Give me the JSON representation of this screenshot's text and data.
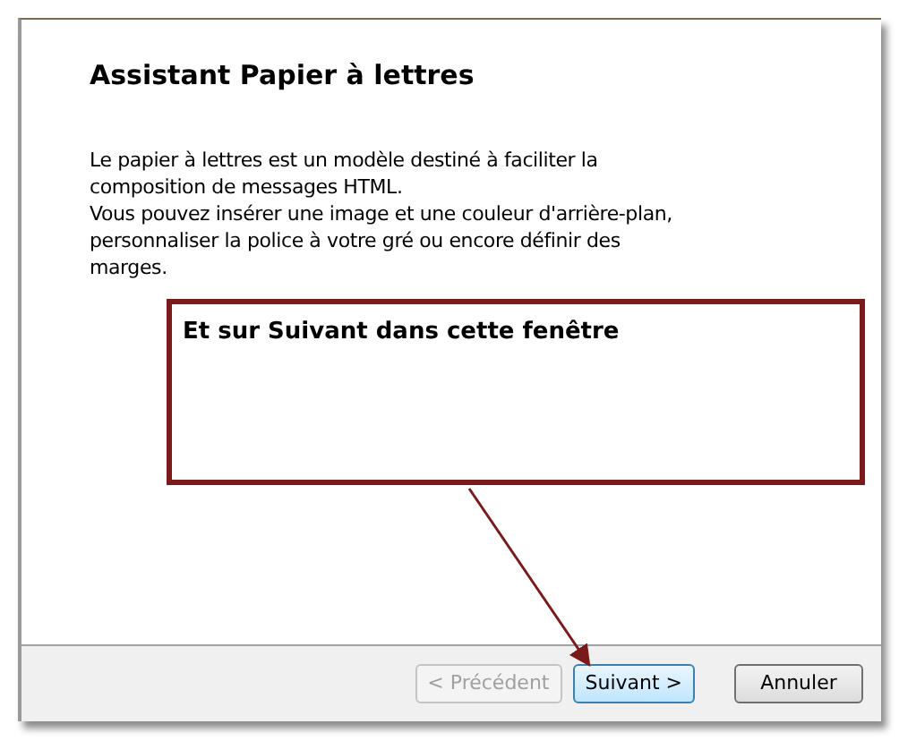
{
  "dialog": {
    "title": "Assistant Papier à lettres",
    "paragraphs": [
      "Le papier à lettres est un modèle destiné à faciliter la composition de messages HTML.",
      "Vous pouvez insérer une image et une couleur d'arrière-plan, personnaliser la police à votre gré ou encore définir des marges."
    ],
    "buttons": [
      {
        "label": "< Précédent",
        "disabled": true,
        "focused": false
      },
      {
        "label": "Suivant >",
        "disabled": false,
        "focused": true
      },
      {
        "label": "Annuler",
        "disabled": false,
        "focused": false
      }
    ]
  },
  "callout": {
    "text": "Et sur Suivant dans cette fenêtre"
  }
}
